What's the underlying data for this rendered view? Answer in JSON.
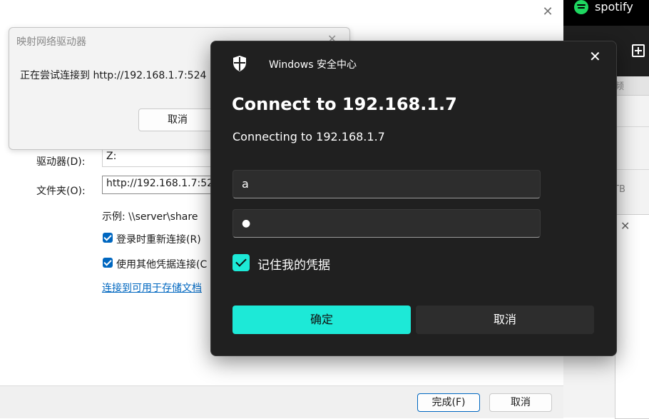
{
  "wizard": {
    "drive_label": "驱动器(D):",
    "drive_value": "Z:",
    "folder_label": "文件夹(O):",
    "folder_value": "http://192.168.1.7:52",
    "example_text": "示例: \\\\server\\share",
    "reconnect_label": "登录时重新连接(R)",
    "reconnect_checked": true,
    "other_creds_label": "使用其他凭据连接(C",
    "other_creds_checked": true,
    "storage_link": "连接到可用于存储文档",
    "finish_button": "完成(F)",
    "cancel_button": "取消"
  },
  "connecting_dialog": {
    "title": "映射网络驱动器",
    "message": "正在尝试连接到 http://192.168.1.7:524",
    "cancel_button": "取消"
  },
  "taskbar_right": {
    "app_name": "spotify",
    "partial_text_1": "频",
    "partial_text_2": "TB"
  },
  "security_dialog": {
    "app_title": "Windows 安全中心",
    "heading": "Connect to 192.168.1.7",
    "subheading": "Connecting to 192.168.1.7",
    "username_value": "a",
    "password_value": "●",
    "remember_label": "记住我的凭据",
    "remember_checked": true,
    "ok_button": "确定",
    "cancel_button": "取消",
    "accent_color": "#1de9d7"
  }
}
